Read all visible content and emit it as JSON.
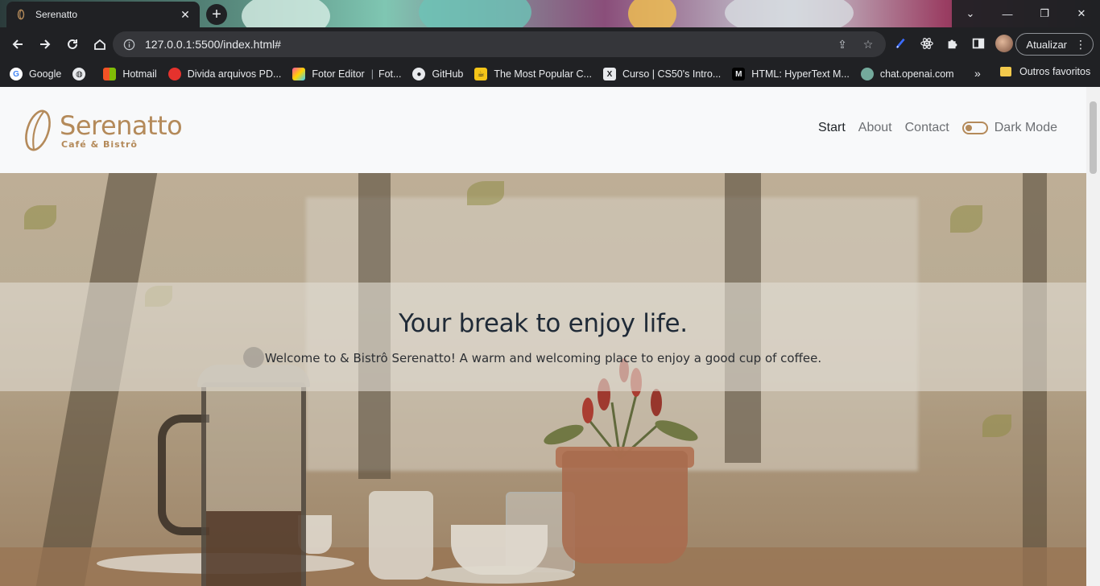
{
  "browser": {
    "tab": {
      "title": "Serenatto",
      "favicon": "coffee-bean-icon"
    },
    "new_tab": "+",
    "window_controls": [
      "chevron-down-icon",
      "minimize-icon",
      "restore-icon",
      "close-icon"
    ],
    "omnibox": {
      "url": "127.0.0.1:5500/index.html#"
    },
    "update_button": "Atualizar",
    "bookmarks": [
      {
        "label": "Google",
        "icon": "google-icon",
        "color": "#ffffff"
      },
      {
        "label": "",
        "icon": "globe-icon",
        "color": "#e8eaed"
      },
      {
        "label": "Hotmail",
        "icon": "microsoft-icon",
        "color": "#f35325"
      },
      {
        "label": "Divida arquivos PD...",
        "icon": "pdf-icon",
        "color": "#e5322d"
      },
      {
        "label": "Fotor Editor",
        "icon": "fotor-icon",
        "color": "#ff4fa0"
      },
      {
        "label": "Fot...",
        "icon": "fotor-icon",
        "color": "#ff4fa0"
      },
      {
        "label": "GitHub",
        "icon": "github-icon",
        "color": "#e8eaed"
      },
      {
        "label": "The Most Popular C...",
        "icon": "cup-icon",
        "color": "#f5c518"
      },
      {
        "label": "Curso | CS50's Intro...",
        "icon": "x-icon",
        "color": "#e8eaed"
      },
      {
        "label": "HTML: HyperText M...",
        "icon": "mdn-icon",
        "color": "#e8eaed"
      },
      {
        "label": "chat.openai.com",
        "icon": "openai-icon",
        "color": "#74aa9c"
      }
    ],
    "bookmarks_more": "»",
    "other_bookmarks": "Outros favoritos"
  },
  "site": {
    "logo": {
      "name": "Serenatto",
      "subtitle": "Café & Bistrô"
    },
    "nav": [
      {
        "label": "Start",
        "active": true
      },
      {
        "label": "About",
        "active": false
      },
      {
        "label": "Contact",
        "active": false
      }
    ],
    "dark_mode_label": "Dark Mode",
    "dark_mode_on": false,
    "brand_color": "#b48a5a",
    "hero": {
      "title": "Your break to enjoy life.",
      "subtitle": "Welcome to & Bistrô Serenatto! A warm and welcoming place to enjoy a good cup of coffee."
    }
  }
}
